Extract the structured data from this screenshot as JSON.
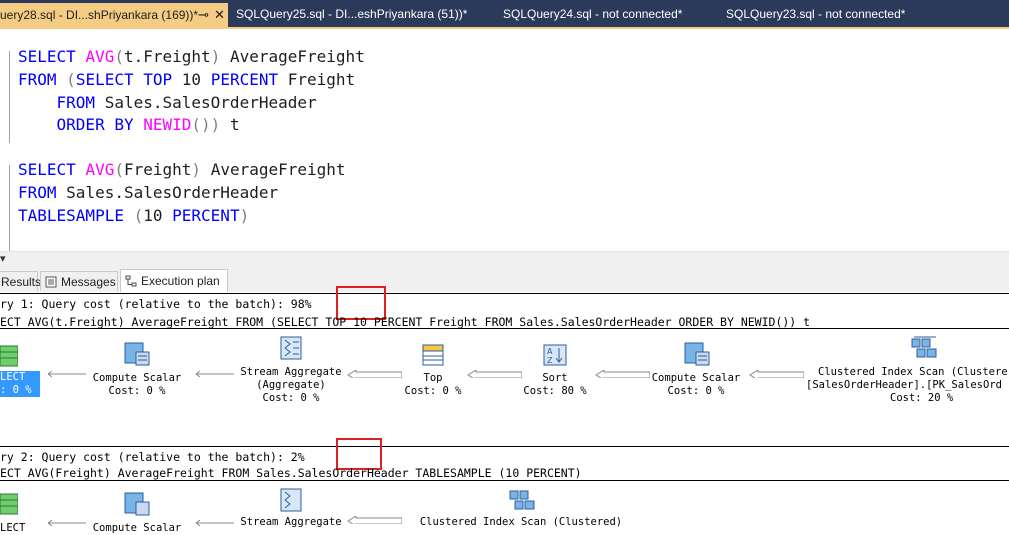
{
  "tabs": [
    {
      "title": "uery28.sql - DI...shPriyankara (169))*",
      "pin": "⊸",
      "close": "✕"
    },
    {
      "title": "SQLQuery25.sql - DI...eshPriyankara (51))*"
    },
    {
      "title": "SQLQuery24.sql - not connected*"
    },
    {
      "title": "SQLQuery23.sql - not connected*"
    }
  ],
  "editor": {
    "q1": {
      "l1": {
        "kw1": "SELECT ",
        "fn": "AVG",
        "p1": "(",
        "tx": "t.Freight",
        "p2": ")",
        "tx2": " AverageFreight"
      },
      "l2": {
        "kw1": "FROM ",
        "p1": "(",
        "kw2": "SELECT TOP ",
        "tx": "10 ",
        "kw3": "PERCENT ",
        "tx2": "Freight"
      },
      "l3": {
        "kw1": "    FROM ",
        "tx": "Sales.SalesOrderHeader"
      },
      "l4": {
        "kw1": "    ORDER BY ",
        "fn": "NEWID",
        "p1": "())",
        "tx": " t"
      }
    },
    "q2": {
      "l1": {
        "kw1": "SELECT ",
        "fn": "AVG",
        "p1": "(",
        "tx": "Freight",
        "p2": ")",
        "tx2": " AverageFreight"
      },
      "l2": {
        "kw1": "FROM ",
        "tx": "Sales.SalesOrderHeader"
      },
      "l3": {
        "kw1": "TABLESAMPLE ",
        "p1": "(",
        "tx": "10 ",
        "kw2": "PERCENT",
        "p2": ")"
      }
    }
  },
  "zoom_arrow": "▾",
  "result_tabs": [
    {
      "label": "Results"
    },
    {
      "label": "Messages"
    },
    {
      "label": "Execution plan"
    }
  ],
  "plan": {
    "q1": {
      "header": "ry 1: Query cost (relative to the batch): ",
      "cost": "98%",
      "sql": "ECT AVG(t.Freight) AverageFreight FROM (SELECT TOP 10 PERCENT Freight FROM Sales.SalesOrderHeader ORDER BY NEWID()) t",
      "ops": [
        {
          "name": "LECT",
          "cost": ": 0 %"
        },
        {
          "name": "Compute Scalar",
          "cost": "Cost: 0 %"
        },
        {
          "name": "Stream Aggregate",
          "sub": "(Aggregate)",
          "cost": "Cost: 0 %"
        },
        {
          "name": "Top",
          "cost": "Cost: 0 %"
        },
        {
          "name": "Sort",
          "cost": "Cost: 80 %"
        },
        {
          "name": "Compute Scalar",
          "cost": "Cost: 0 %"
        },
        {
          "name": "Clustered Index Scan (Clustere",
          "sub": "[SalesOrderHeader].[PK_SalesOrd",
          "cost": "Cost: 20 %"
        }
      ]
    },
    "q2": {
      "header": "ry 2: Query cost (relative to the batch): ",
      "cost": "2%",
      "sql": "ECT AVG(Freight) AverageFreight FROM Sales.SalesOrderHeader TABLESAMPLE (10 PERCENT)",
      "ops": [
        {
          "name": "LECT"
        },
        {
          "name": "Compute Scalar"
        },
        {
          "name": "Stream Aggregate"
        },
        {
          "name": "Clustered Index Scan (Clustered)"
        }
      ]
    }
  },
  "colors": {
    "tab_active": "#f5cc84",
    "tabbar": "#2b3a5a",
    "keyword": "#0000ff",
    "function": "#ff00ff",
    "highlight": "#e02020",
    "selected_op": "#3399ff"
  }
}
